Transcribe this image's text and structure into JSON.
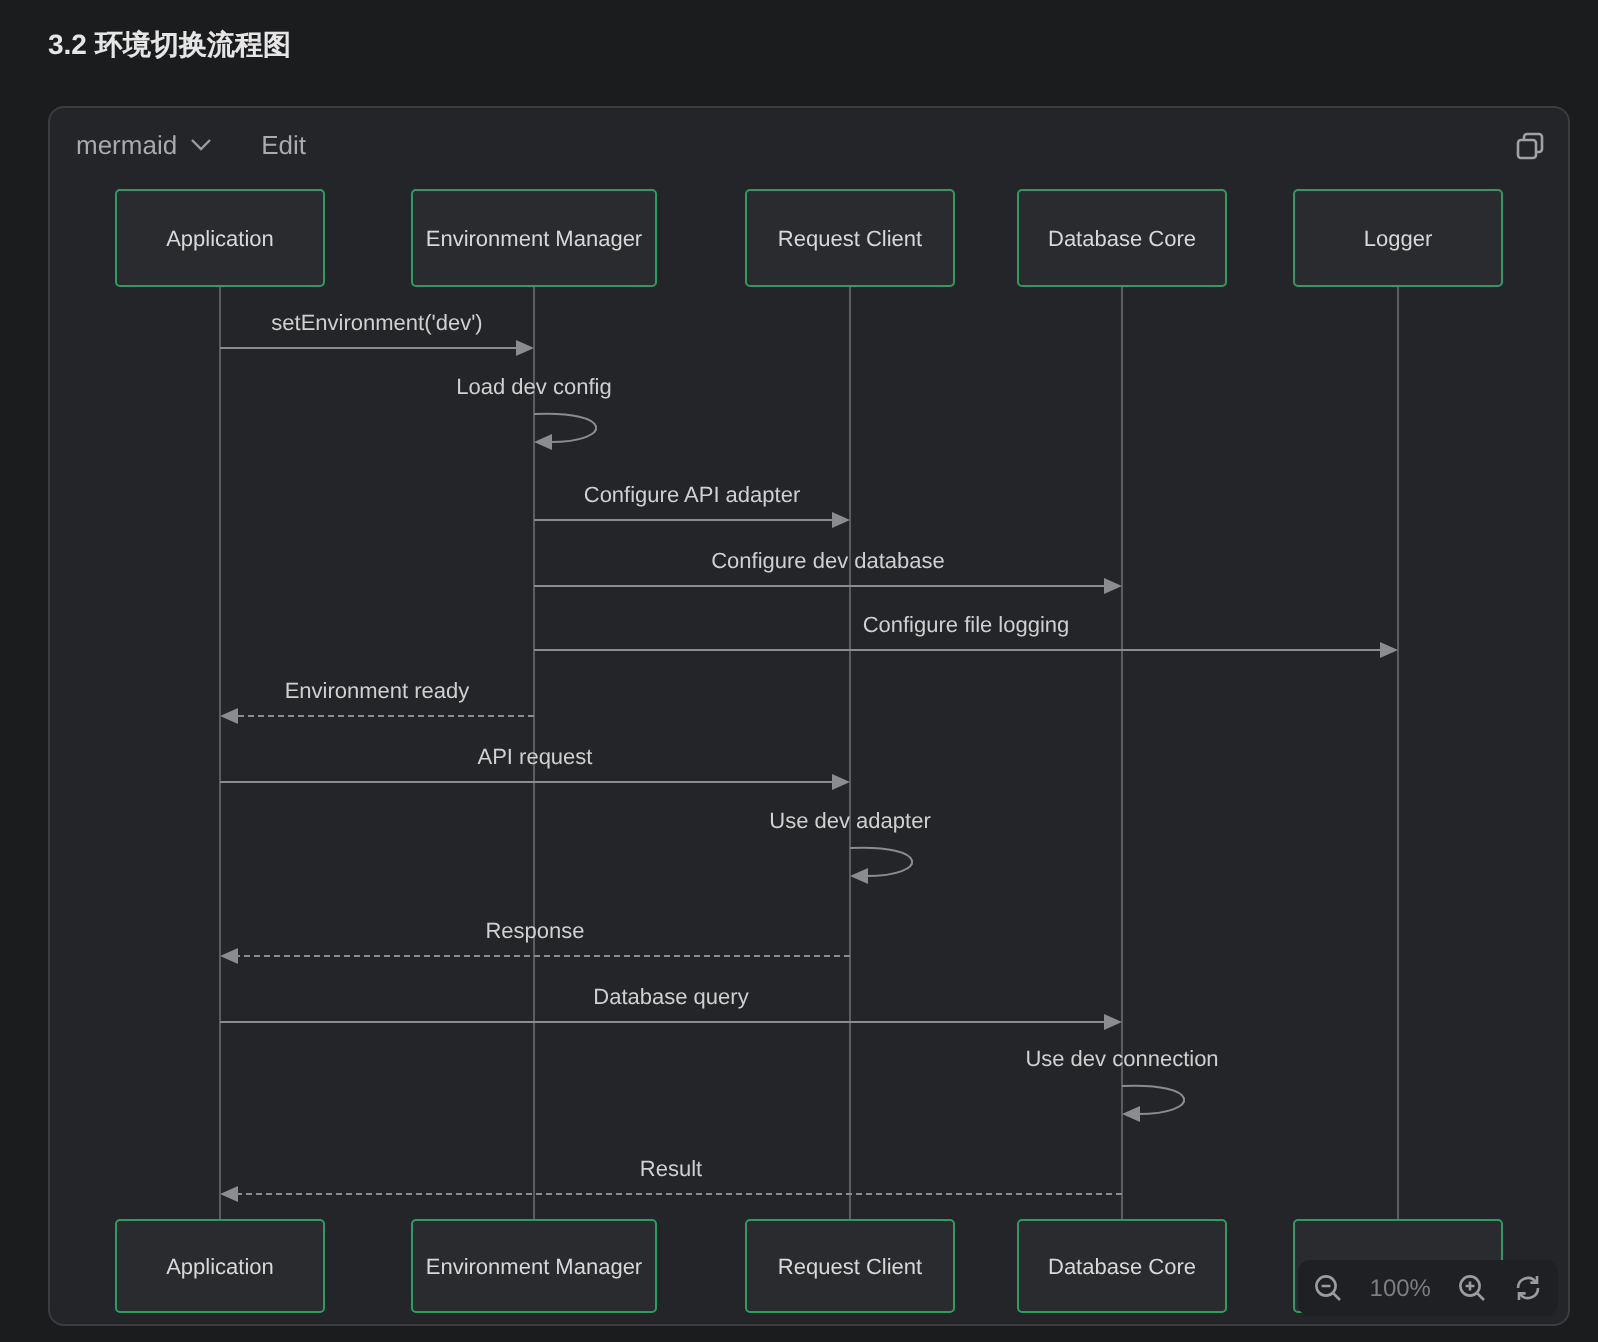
{
  "heading": "3.2 环境切换流程图",
  "toolbar": {
    "language": "mermaid",
    "edit": "Edit"
  },
  "participants": [
    {
      "name": "Application"
    },
    {
      "name": "Environment Manager"
    },
    {
      "name": "Request Client"
    },
    {
      "name": "Database Core"
    },
    {
      "name": "Logger"
    }
  ],
  "bottom_labels": [
    "Application",
    "Environment Manager",
    "Request Client",
    "Database Core"
  ],
  "messages": [
    {
      "kind": "sync",
      "label": "setEnvironment('dev')"
    },
    {
      "kind": "self",
      "label": "Load dev config"
    },
    {
      "kind": "sync",
      "label": "Configure API adapter"
    },
    {
      "kind": "sync",
      "label": "Configure dev database"
    },
    {
      "kind": "sync",
      "label": "Configure file logging"
    },
    {
      "kind": "reply",
      "label": "Environment ready"
    },
    {
      "kind": "sync",
      "label": "API request"
    },
    {
      "kind": "self",
      "label": "Use dev adapter"
    },
    {
      "kind": "reply",
      "label": "Response"
    },
    {
      "kind": "sync",
      "label": "Database query"
    },
    {
      "kind": "self",
      "label": "Use dev connection"
    },
    {
      "kind": "reply",
      "label": "Result"
    }
  ],
  "zoom": {
    "reading": "100%"
  }
}
